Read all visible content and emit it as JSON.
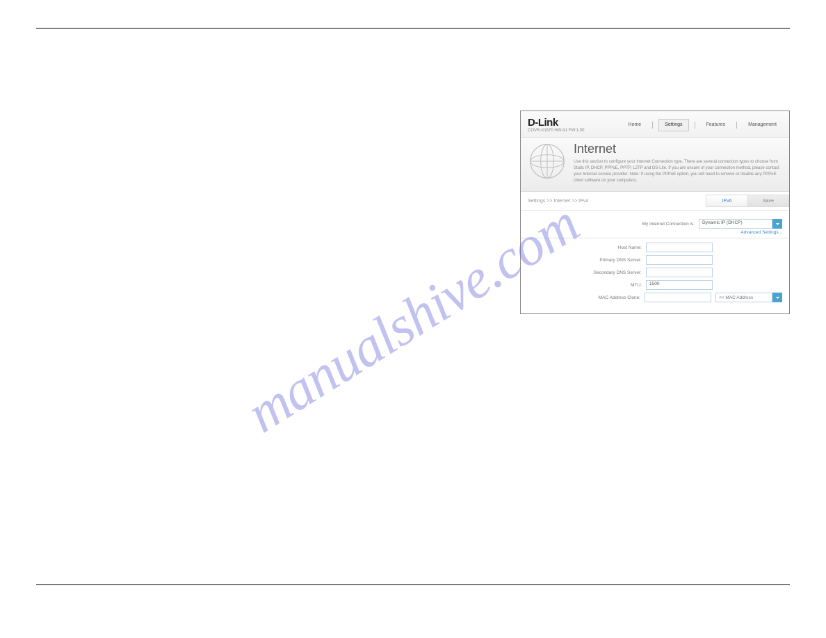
{
  "watermark": "manualshive.com",
  "router": {
    "brand": "D-Link",
    "model_line": "COVR-X1870   HW:A1 FW:1.00",
    "nav": {
      "home": "Home",
      "settings": "Settings",
      "features": "Features",
      "management": "Management"
    },
    "banner": {
      "title": "Internet",
      "desc": "Use this section to configure your Internet Connection type. There are several connection types to choose from Static IP, DHCP, PPPoE, PPTP, L2TP and DS-Lite. If you are unsure of your connection method, please contact your Internet service provider. Note: If using the PPPoE option, you will need to remove or disable any PPPoE client software on your computers."
    },
    "crumb": "Settings >> Internet >> IPv4",
    "buttons": {
      "ipv6": "IPv6",
      "save": "Save"
    },
    "connection_label": "My Internet Connection is:",
    "connection_value": "Dynamic IP (DHCP)",
    "advanced_label": "Advanced Settings...",
    "fields": {
      "hostname_label": "Host Name:",
      "hostname_value": "",
      "pdns_label": "Primary DNS Server:",
      "pdns_value": "",
      "sdns_label": "Secondary DNS Server:",
      "sdns_value": "",
      "mtu_label": "MTU:",
      "mtu_value": "1500",
      "mac_label": "MAC Address Clone:",
      "mac_value": "",
      "mac_select": "<< MAC Address"
    }
  }
}
